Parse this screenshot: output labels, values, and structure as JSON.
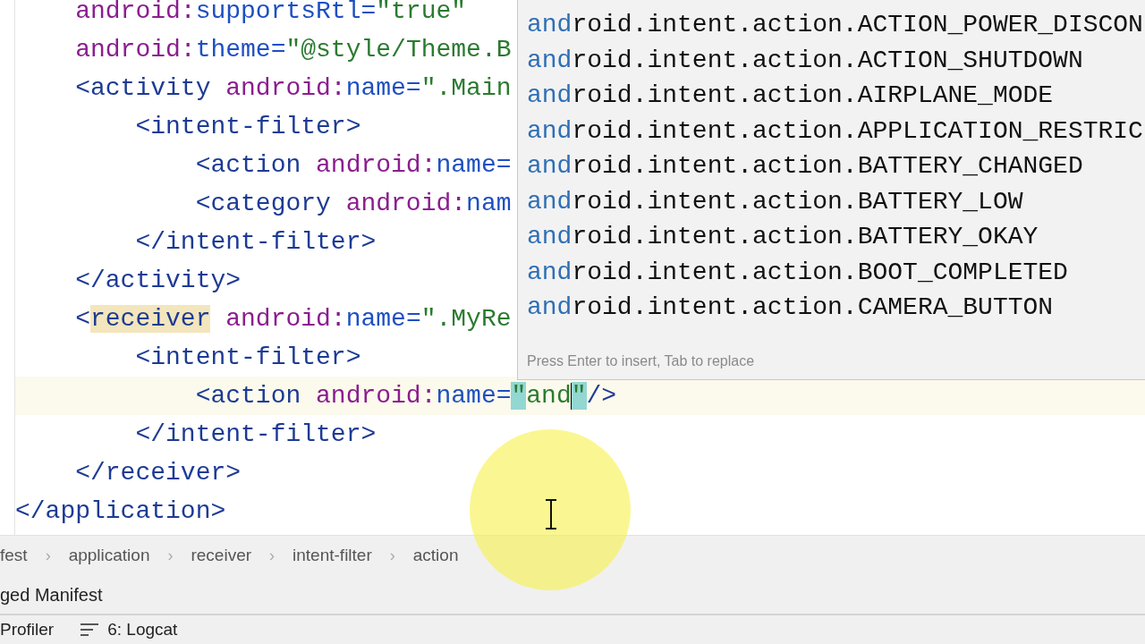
{
  "editor": {
    "lines": [
      {
        "children": [
          {
            "tokens": [
              {
                "kind": "ns",
                "text": "android:"
              },
              {
                "kind": "attr",
                "text": "supportsRtl="
              },
              {
                "kind": "value",
                "text": "\"true\""
              }
            ]
          },
          {
            "tokens": [
              {
                "kind": "ns",
                "text": "android:"
              },
              {
                "kind": "attr",
                "text": "theme="
              },
              {
                "kind": "value",
                "text": "\"@style/Theme.B"
              }
            ]
          },
          {
            "tokens": [
              {
                "kind": "tag",
                "text": "<activity "
              },
              {
                "kind": "ns",
                "text": "android:"
              },
              {
                "kind": "attr",
                "text": "name="
              },
              {
                "kind": "value",
                "text": "\".Main"
              }
            ],
            "children": [
              {
                "tokens": [
                  {
                    "kind": "tag",
                    "text": "<intent-filter>"
                  }
                ],
                "children": [
                  {
                    "tokens": [
                      {
                        "kind": "tag",
                        "text": "<action "
                      },
                      {
                        "kind": "ns",
                        "text": "android:"
                      },
                      {
                        "kind": "attr",
                        "text": "name="
                      }
                    ]
                  },
                  {
                    "tokens": [
                      {
                        "kind": "tag",
                        "text": "<category "
                      },
                      {
                        "kind": "ns",
                        "text": "android:"
                      },
                      {
                        "kind": "attr",
                        "text": "nam"
                      }
                    ]
                  }
                ]
              },
              {
                "tokens": [
                  {
                    "kind": "tag",
                    "text": "</intent-filter>"
                  }
                ]
              }
            ]
          },
          {
            "tokens": [
              {
                "kind": "tag",
                "text": "</activity>"
              }
            ]
          },
          {
            "tokens": [
              {
                "kind": "tag",
                "text": "<"
              },
              {
                "kind": "tag",
                "text": "receiver",
                "highlighted": true
              },
              {
                "kind": "ns",
                "text": " android:"
              },
              {
                "kind": "attr",
                "text": "name="
              },
              {
                "kind": "value",
                "text": "\".MyRe"
              }
            ],
            "children": [
              {
                "tokens": [
                  {
                    "kind": "tag",
                    "text": "<intent-filter>"
                  }
                ],
                "children": [
                  {
                    "current": true,
                    "tokens": [
                      {
                        "kind": "tag",
                        "text": "<action "
                      },
                      {
                        "kind": "ns",
                        "text": "android:"
                      },
                      {
                        "kind": "attr",
                        "text": "name="
                      },
                      {
                        "kind": "value",
                        "text": "\"",
                        "matched": true
                      },
                      {
                        "kind": "value",
                        "text": "and"
                      },
                      {
                        "kind": "caret"
                      },
                      {
                        "kind": "value",
                        "text": "\"",
                        "matched": true
                      },
                      {
                        "kind": "tag",
                        "text": "/>"
                      }
                    ]
                  }
                ]
              },
              {
                "tokens": [
                  {
                    "kind": "tag",
                    "text": "</intent-filter>"
                  }
                ]
              }
            ]
          },
          {
            "tokens": [
              {
                "kind": "tag",
                "text": "</receiver>"
              }
            ]
          }
        ]
      },
      {
        "tokens": [
          {
            "kind": "tag",
            "text": "</application>"
          }
        ]
      }
    ]
  },
  "completion": {
    "items": [
      {
        "match": "and",
        "rest": "roid.intent.action.ACTION_POWER_DISCON",
        "selected": false
      },
      {
        "match": "and",
        "rest": "roid.intent.action.ACTION_SHUTDOWN",
        "selected": false
      },
      {
        "match": "and",
        "rest": "roid.intent.action.AIRPLANE_MODE",
        "selected": false
      },
      {
        "match": "and",
        "rest": "roid.intent.action.APPLICATION_RESTRIC",
        "selected": false
      },
      {
        "match": "and",
        "rest": "roid.intent.action.BATTERY_CHANGED",
        "selected": false
      },
      {
        "match": "and",
        "rest": "roid.intent.action.BATTERY_LOW",
        "selected": false
      },
      {
        "match": "and",
        "rest": "roid.intent.action.BATTERY_OKAY",
        "selected": false
      },
      {
        "match": "and",
        "rest": "roid.intent.action.BOOT_COMPLETED",
        "selected": false
      },
      {
        "match": "and",
        "rest": "roid.intent.action.CAMERA_BUTTON",
        "selected": false
      }
    ],
    "hint": "Press Enter to insert, Tab to replace"
  },
  "breadcrumbs": [
    {
      "label": "fest"
    },
    {
      "separator": "›",
      "label": "application"
    },
    {
      "separator": "›",
      "label": "receiver"
    },
    {
      "separator": "›",
      "label": "intent-filter"
    },
    {
      "separator": "›",
      "label": "action"
    }
  ],
  "editor_tab": "ged Manifest",
  "tool_windows": [
    {
      "kind": "plain",
      "label": "Profiler"
    },
    {
      "kind": "list",
      "label": "6: Logcat"
    }
  ]
}
